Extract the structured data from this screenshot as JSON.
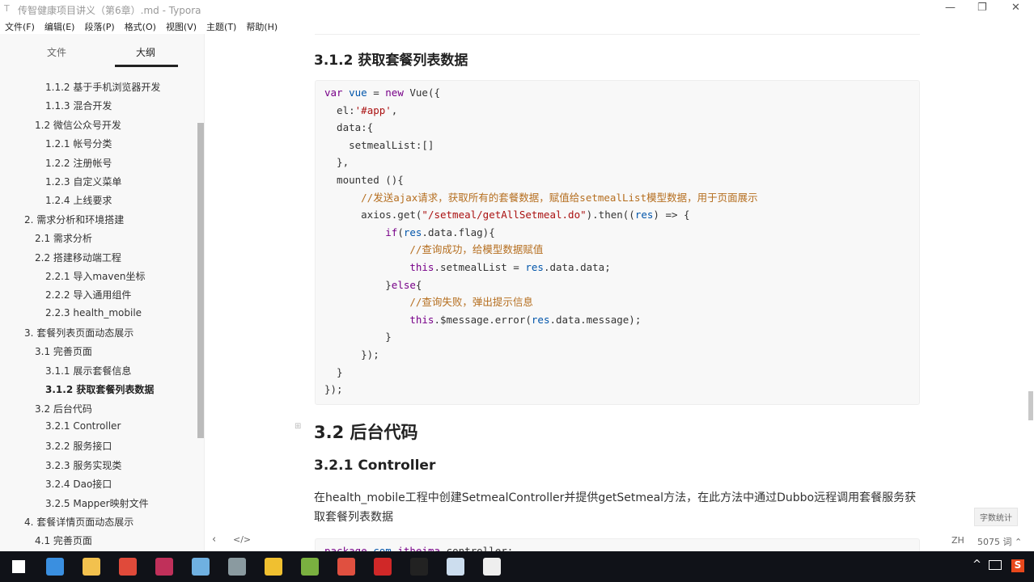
{
  "window": {
    "title": "传智健康项目讲义（第6章）.md - Typora",
    "minimize": "—",
    "restore": "❐",
    "close": "✕"
  },
  "menu": [
    "文件(F)",
    "编辑(E)",
    "段落(P)",
    "格式(O)",
    "视图(V)",
    "主题(T)",
    "帮助(H)"
  ],
  "sidebar": {
    "tabs": [
      "文件",
      "大纲"
    ],
    "active_tab": "大纲",
    "outline": [
      {
        "label": "1.1.2 基于手机浏览器开发",
        "level": 3
      },
      {
        "label": "1.1.3 混合开发",
        "level": 3
      },
      {
        "label": "1.2 微信公众号开发",
        "level": 2
      },
      {
        "label": "1.2.1 帐号分类",
        "level": 3
      },
      {
        "label": "1.2.2 注册帐号",
        "level": 3
      },
      {
        "label": "1.2.3 自定义菜单",
        "level": 3
      },
      {
        "label": "1.2.4 上线要求",
        "level": 3
      },
      {
        "label": "2. 需求分析和环境搭建",
        "level": 1
      },
      {
        "label": "2.1 需求分析",
        "level": 2
      },
      {
        "label": "2.2 搭建移动端工程",
        "level": 2
      },
      {
        "label": "2.2.1 导入maven坐标",
        "level": 3
      },
      {
        "label": "2.2.2 导入通用组件",
        "level": 3
      },
      {
        "label": "2.2.3 health_mobile",
        "level": 3
      },
      {
        "label": "3. 套餐列表页面动态展示",
        "level": 1
      },
      {
        "label": "3.1 完善页面",
        "level": 2
      },
      {
        "label": "3.1.1 展示套餐信息",
        "level": 3
      },
      {
        "label": "3.1.2 获取套餐列表数据",
        "level": 3,
        "active": true
      },
      {
        "label": "3.2 后台代码",
        "level": 2
      },
      {
        "label": "3.2.1 Controller",
        "level": 3
      },
      {
        "label": "3.2.2 服务接口",
        "level": 3
      },
      {
        "label": "3.2.3 服务实现类",
        "level": 3
      },
      {
        "label": "3.2.4 Dao接口",
        "level": 3
      },
      {
        "label": "3.2.5 Mapper映射文件",
        "level": 3
      },
      {
        "label": "4. 套餐详情页面动态展示",
        "level": 1
      },
      {
        "label": "4.1 完善页面",
        "level": 2
      }
    ]
  },
  "doc": {
    "h_312": "3.1.2 获取套餐列表数据",
    "code1": [
      [
        [
          "kw",
          "var "
        ],
        [
          "vr",
          "vue"
        ],
        [
          "def",
          " = "
        ],
        [
          "kw",
          "new "
        ],
        [
          "def",
          "Vue({"
        ]
      ],
      [
        [
          "def",
          "  el:"
        ],
        [
          "st",
          "'#app'"
        ],
        [
          "def",
          ","
        ]
      ],
      [
        [
          "def",
          "  data:{"
        ]
      ],
      [
        [
          "def",
          "    setmealList:[]"
        ]
      ],
      [
        [
          "def",
          "  },"
        ]
      ],
      [
        [
          "def",
          "  mounted (){"
        ]
      ],
      [
        [
          "cm",
          "      //发送ajax请求，获取所有的套餐数据，赋值给setmealList模型数据，用于页面展示"
        ]
      ],
      [
        [
          "def",
          "      axios.get("
        ],
        [
          "st",
          "\"/setmeal/getAllSetmeal.do\""
        ],
        [
          "def",
          ").then(("
        ],
        [
          "vr",
          "res"
        ],
        [
          "def",
          ") => {"
        ]
      ],
      [
        [
          "kw",
          "          if"
        ],
        [
          "def",
          "("
        ],
        [
          "vr",
          "res"
        ],
        [
          "def",
          ".data.flag){"
        ]
      ],
      [
        [
          "cm",
          "              //查询成功，给模型数据赋值"
        ]
      ],
      [
        [
          "kw",
          "              this"
        ],
        [
          "def",
          ".setmealList = "
        ],
        [
          "vr",
          "res"
        ],
        [
          "def",
          ".data.data;"
        ]
      ],
      [
        [
          "def",
          "          }"
        ],
        [
          "kw",
          "else"
        ],
        [
          "def",
          "{"
        ]
      ],
      [
        [
          "cm",
          "              //查询失败，弹出提示信息"
        ]
      ],
      [
        [
          "kw",
          "              this"
        ],
        [
          "def",
          ".$message.error("
        ],
        [
          "vr",
          "res"
        ],
        [
          "def",
          ".data.message);"
        ]
      ],
      [
        [
          "def",
          "          }"
        ]
      ],
      [
        [
          "def",
          "      });"
        ]
      ],
      [
        [
          "def",
          "  }"
        ]
      ],
      [
        [
          "def",
          "});"
        ]
      ]
    ],
    "h_32": "3.2 后台代码",
    "h_321": "3.2.1 Controller",
    "paragraph": "在health_mobile工程中创建SetmealController并提供getSetmeal方法，在此方法中通过Dubbo远程调用套餐服务获取套餐列表数据",
    "code2_first": [
      [
        "kw",
        "package "
      ],
      [
        "vr",
        "com"
      ],
      [
        "def",
        "."
      ],
      [
        "kw",
        "itheima"
      ],
      [
        "def",
        ".controller;"
      ]
    ]
  },
  "word_count_button": "字数统计",
  "status": {
    "lang": "ZH",
    "words": "5075 词 ⌃"
  },
  "taskbar": {
    "icons": [
      "windows-start",
      "desktop",
      "file-explorer",
      "chrome",
      "intellij-idea",
      "paint",
      "virtual-machine",
      "gold-app",
      "notepad-plus",
      "visual-app",
      "redis-desktop",
      "cmd",
      "window-app",
      "typora"
    ],
    "colors": [
      "#2d7fd0",
      "#3a8fe0",
      "#f2c14e",
      "#e04a3a",
      "#c0305a",
      "#6fb0e0",
      "#8a9aa0",
      "#f0c030",
      "#7ab040",
      "#e05040",
      "#d02828",
      "#222",
      "#cde",
      "#eee"
    ]
  },
  "tray": {
    "ime": "S",
    "ime_color": "#e8481c"
  }
}
